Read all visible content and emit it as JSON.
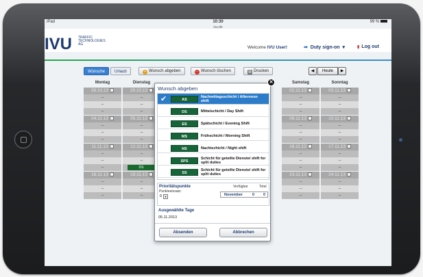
{
  "status": {
    "left": "iPad",
    "time": "10:30",
    "url": "ivu.de",
    "battery": "99 %"
  },
  "header": {
    "logo": "IVU",
    "logo_sub": [
      "TRAFFIC",
      "TECHNOLOGIES",
      "AG"
    ],
    "welcome_prefix": "Welcome",
    "welcome_user": "IVU User!",
    "duty": "Duty sign-on",
    "logout": "Log out"
  },
  "toolbar": {
    "tab_wuensche": "Wünsche",
    "tab_urlaub": "Urlaub",
    "wunsch_abgeben": "Wunsch abgeben",
    "wunsch_loeschen": "Wunsch löschen",
    "drucken": "Drucken",
    "heute": "Heute",
    "prev": "◀",
    "next": "▶"
  },
  "calendar": {
    "days": [
      "Montag",
      "Dienstag",
      "",
      "",
      "",
      "Samstag",
      "Sonntag"
    ],
    "week_dates": [
      [
        "28.10.13",
        "29.10.13",
        "",
        "",
        "",
        "02.11.13",
        "03.11.13"
      ],
      [
        "04.11.13",
        "05.11.13",
        "",
        "",
        "",
        "09.11.13",
        "10.11.13"
      ],
      [
        "11.11.13",
        "12.11.13",
        "",
        "",
        "",
        "16.11.13",
        "17.11.13"
      ],
      [
        "18.11.13",
        "19.11.13",
        "",
        "",
        "",
        "23.11.13",
        "24.11.13"
      ]
    ],
    "dash": "–",
    "selected_shift": "DS"
  },
  "modal": {
    "title": "Wunsch abgeben",
    "close": "✕",
    "items": [
      {
        "code": "AS",
        "label": "Nachmittagsschicht / Afternoon shift",
        "selected": true
      },
      {
        "code": "DS",
        "label": "Mittelschicht / Day Shift",
        "selected": false
      },
      {
        "code": "ES",
        "label": "Spätschicht / Evening Shift",
        "selected": false
      },
      {
        "code": "MS",
        "label": "Frühschicht / Morning Shift",
        "selected": false
      },
      {
        "code": "NS",
        "label": "Nachtschicht / Night shift",
        "selected": false
      },
      {
        "code": "SPS",
        "label": "Schicht für geteilte Dienste/ shift for split duties",
        "selected": false
      },
      {
        "code": "SS",
        "label": "Schicht für geteilte Dienste/ shift for split duties",
        "selected": false
      }
    ],
    "prio": {
      "title": "Prioritätspunkte",
      "subtitle": "Punkteeinsatz:",
      "verfuegbar": "Verfügbar",
      "total": "Total",
      "value": "0",
      "month": "November",
      "available_value": "0",
      "total_value": "0"
    },
    "selected_days": {
      "title": "Ausgewählte Tage",
      "date": "05.11.2013"
    },
    "absenden": "Absenden",
    "abbrechen": "Abbrechen"
  }
}
